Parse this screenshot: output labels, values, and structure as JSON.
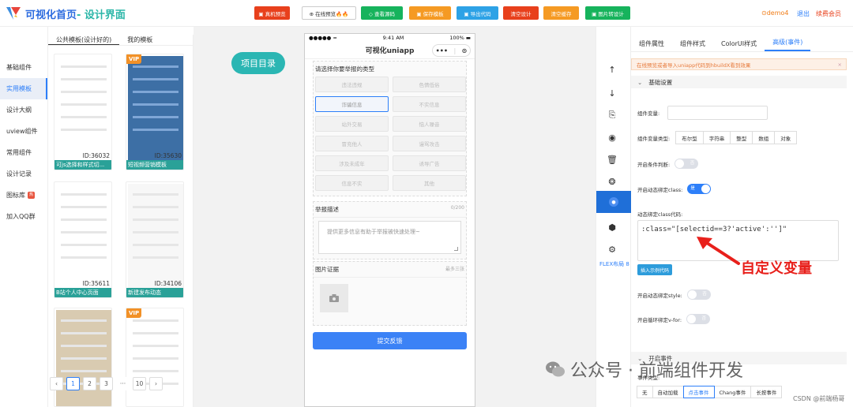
{
  "header": {
    "logo_title_main": "可视化首页",
    "logo_title_sub": "- 设计界面",
    "buttons": [
      {
        "label": "▣ 真机预览",
        "color": "#e8401c"
      },
      {
        "label": "⊕ 在线预览🔥🔥",
        "color": "#ffffff"
      },
      {
        "label": "◇ 查看源码",
        "color": "#16b35c"
      },
      {
        "label": "▣ 保存模板",
        "color": "#f59a23"
      },
      {
        "label": "▣ 导出代码",
        "color": "#2da2e6"
      },
      {
        "label": "清空设计",
        "color": "#e8401c"
      },
      {
        "label": "清空缓存",
        "color": "#f59a23"
      },
      {
        "label": "▣ 图片转设计",
        "color": "#16b35c"
      }
    ],
    "user": "⊙demo4",
    "logout": "退出",
    "renew": "续费会员"
  },
  "leftnav": {
    "items": [
      "基础组件",
      "实用模板",
      "设计大纲",
      "uview组件",
      "常用组件",
      "设计记录",
      "图标库",
      "加入QQ群"
    ],
    "active_index": 1,
    "hot_badge": "热"
  },
  "templates": {
    "tabs": [
      "公共模板(设计好的)",
      "我的模板"
    ],
    "cards": [
      {
        "id": "ID:36032",
        "caption": "可js选择和样式切...",
        "vip": false
      },
      {
        "id": "ID:35630",
        "caption": "短视频营销模板",
        "vip": true
      },
      {
        "id": "ID:35611",
        "caption": "B站个人中心页面",
        "vip": false
      },
      {
        "id": "ID:34106",
        "caption": "新建发布动态",
        "vip": false
      },
      {
        "id": "",
        "caption": "",
        "vip": false
      },
      {
        "id": "",
        "caption": "",
        "vip": true
      }
    ],
    "vip_label": "VIP",
    "pager": [
      "‹",
      "1",
      "2",
      "3",
      "···",
      "10",
      "›"
    ],
    "pager_active": 1
  },
  "canvas": {
    "dir_button": "项目目录",
    "phone": {
      "status_left": "●●●●● ≈",
      "status_time": "9:41 AM",
      "status_right": "100% ▬",
      "title": "可视化uniapp",
      "capsule_dots": "•••",
      "capsule_target": "⊙",
      "reason_title": "请选择你要举报的类型",
      "reasons": [
        "违法违规",
        "色情低俗",
        "诈骗信息",
        "不实信息",
        "站外交易",
        "恼人噪音",
        "冒充他人",
        "谩骂攻击",
        "涉及未成年",
        "诱导广告",
        "信息不实",
        "其他"
      ],
      "reason_selected": 2,
      "desc_title": "举报描述",
      "desc_count": "0/200",
      "desc_placeholder": "提供更多信息有助于举报被快速处理~",
      "evidence_title": "图片证据",
      "evidence_limit": "最多三张",
      "submit": "提交反馈"
    }
  },
  "iconbar": {
    "icons": [
      "arrow-up-icon",
      "arrow-down-icon",
      "copy-icon",
      "compass-icon",
      "trash-icon",
      "aperture-icon",
      "target-icon",
      "shield-icon",
      "gear-icon"
    ],
    "glyphs": [
      "↑",
      "↓",
      "⎘",
      "◉",
      "🗑",
      "❂",
      "●",
      "⬢",
      "⚙"
    ],
    "active_index": 6,
    "flex_label": "FLEX布局 8"
  },
  "props": {
    "tabs": [
      "组件属性",
      "组件样式",
      "ColorUI样式",
      "高级(事件)"
    ],
    "active_tab": 3,
    "alert": "在线预览或者导入uniapp代码到hbuildX看到效果",
    "alert_close": "×",
    "basic_group": "基础设置",
    "var_label": "组件变量:",
    "var_type_label": "组件变量类型:",
    "var_types": [
      "布尔型",
      "字符串",
      "整型",
      "数组",
      "对象"
    ],
    "cond_label": "开启条件判断:",
    "cond_switch": "否",
    "dyn_class_label": "开启动态绑定class:",
    "dyn_class_switch": "是",
    "code_label": "动态绑定class代码:",
    "code_value": ":class=\"[selectid==3?'active':'']\"",
    "insert_example": "插入示例代码",
    "dyn_style_label": "开启动态绑定style:",
    "dyn_style_switch": "否",
    "loop_label": "开启循环绑定v-for:",
    "loop_switch": "否",
    "event_group": "开启事件",
    "event_type_label": "事件类型:",
    "event_types": [
      "无",
      "自动加载",
      "点击事件",
      "Chang事件",
      "长按事件"
    ],
    "event_active": 2
  },
  "annotation": "自定义变量",
  "watermark": {
    "text": "公众号 · 前端组件开发",
    "sub": "CSDN @前端杨哥"
  }
}
